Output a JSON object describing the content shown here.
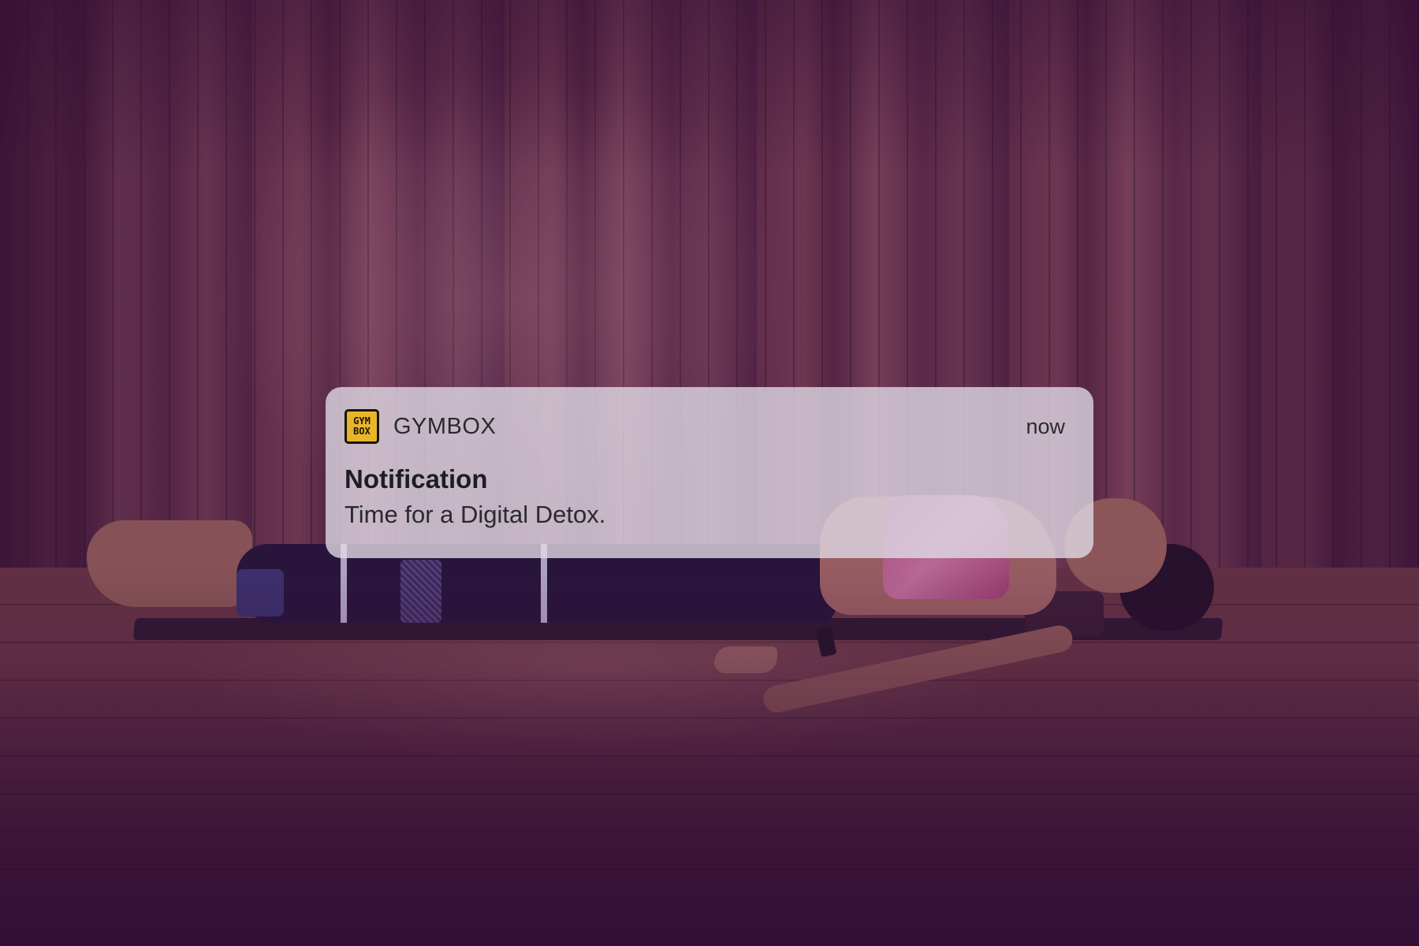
{
  "notification": {
    "app_icon": {
      "name": "gymbox-logo-icon",
      "line1": "GYM",
      "line2": "BOX",
      "color": "#e8b52a"
    },
    "app_name": "GYMBOX",
    "timestamp": "now",
    "title": "Notification",
    "body": "Time for a Digital Detox."
  },
  "background": {
    "tint": "#461450"
  }
}
